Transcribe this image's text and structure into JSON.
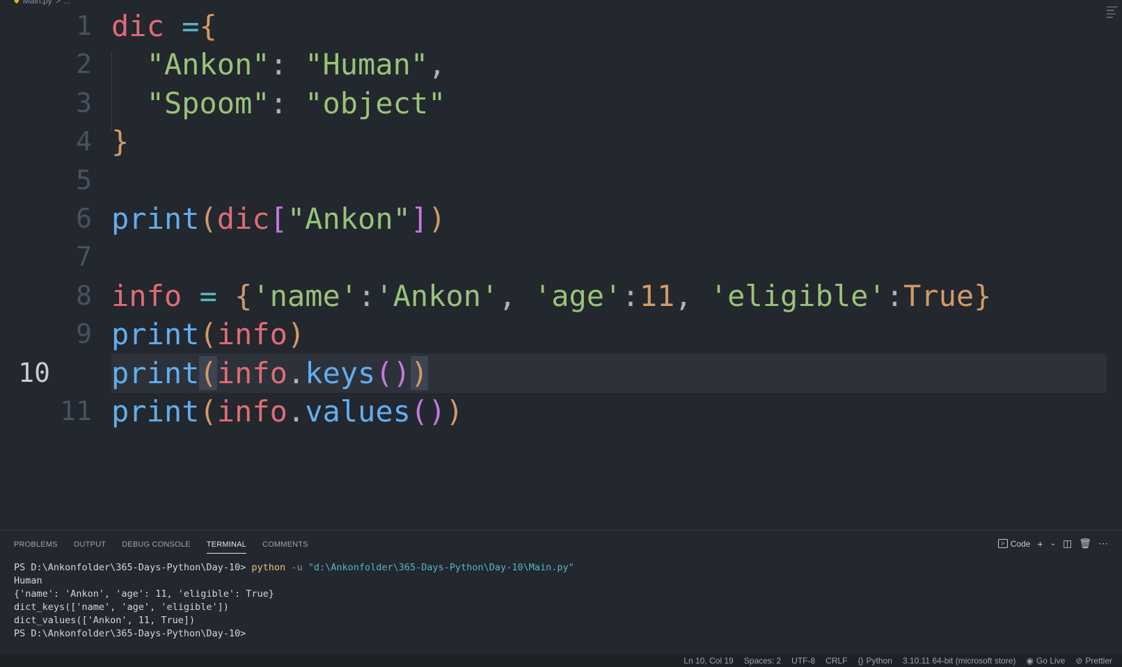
{
  "breadcrumb": {
    "file": "Main.py",
    "sep": ">",
    "rest": "..."
  },
  "editor": {
    "current_line": "10",
    "lines": [
      {
        "num": "1",
        "tokens": [
          {
            "t": "dic",
            "c": "t-var"
          },
          {
            "t": " ",
            "c": "t-punc"
          },
          {
            "t": "=",
            "c": "t-op"
          },
          {
            "t": "{",
            "c": "t-brace"
          }
        ]
      },
      {
        "num": "2",
        "tokens": [
          {
            "t": "  ",
            "c": "t-punc"
          },
          {
            "t": "\"Ankon\"",
            "c": "t-str"
          },
          {
            "t": ": ",
            "c": "t-punc"
          },
          {
            "t": "\"Human\"",
            "c": "t-str"
          },
          {
            "t": ",",
            "c": "t-punc"
          }
        ]
      },
      {
        "num": "3",
        "tokens": [
          {
            "t": "  ",
            "c": "t-punc"
          },
          {
            "t": "\"Spoom\"",
            "c": "t-str"
          },
          {
            "t": ": ",
            "c": "t-punc"
          },
          {
            "t": "\"object\"",
            "c": "t-str"
          }
        ]
      },
      {
        "num": "4",
        "tokens": [
          {
            "t": "}",
            "c": "t-brace"
          }
        ]
      },
      {
        "num": "5",
        "tokens": []
      },
      {
        "num": "6",
        "tokens": [
          {
            "t": "print",
            "c": "t-fn"
          },
          {
            "t": "(",
            "c": "t-paren1"
          },
          {
            "t": "dic",
            "c": "t-var"
          },
          {
            "t": "[",
            "c": "t-paren2"
          },
          {
            "t": "\"Ankon\"",
            "c": "t-str"
          },
          {
            "t": "]",
            "c": "t-paren2"
          },
          {
            "t": ")",
            "c": "t-paren1"
          }
        ]
      },
      {
        "num": "7",
        "tokens": []
      },
      {
        "num": "8",
        "tokens": [
          {
            "t": "info",
            "c": "t-var"
          },
          {
            "t": " ",
            "c": "t-punc"
          },
          {
            "t": "=",
            "c": "t-op"
          },
          {
            "t": " ",
            "c": "t-punc"
          },
          {
            "t": "{",
            "c": "t-brace"
          },
          {
            "t": "'name'",
            "c": "t-str"
          },
          {
            "t": ":",
            "c": "t-punc"
          },
          {
            "t": "'Ankon'",
            "c": "t-str"
          },
          {
            "t": ", ",
            "c": "t-punc"
          },
          {
            "t": "'age'",
            "c": "t-str"
          },
          {
            "t": ":",
            "c": "t-punc"
          },
          {
            "t": "11",
            "c": "t-num"
          },
          {
            "t": ", ",
            "c": "t-punc"
          },
          {
            "t": "'eligible'",
            "c": "t-str"
          },
          {
            "t": ":",
            "c": "t-punc"
          },
          {
            "t": "True",
            "c": "t-bool"
          },
          {
            "t": "}",
            "c": "t-brace"
          }
        ]
      },
      {
        "num": "9",
        "tokens": [
          {
            "t": "print",
            "c": "t-fn"
          },
          {
            "t": "(",
            "c": "t-paren1"
          },
          {
            "t": "info",
            "c": "t-var"
          },
          {
            "t": ")",
            "c": "t-paren1"
          }
        ]
      },
      {
        "num": "10",
        "tokens": [
          {
            "t": "print",
            "c": "t-fn"
          },
          {
            "t": "(",
            "c": "t-paren1 t-match"
          },
          {
            "t": "info",
            "c": "t-var"
          },
          {
            "t": ".",
            "c": "t-punc"
          },
          {
            "t": "keys",
            "c": "t-fn"
          },
          {
            "t": "(",
            "c": "t-paren2"
          },
          {
            "t": ")",
            "c": "t-paren2"
          },
          {
            "t": ")",
            "c": "t-paren1 t-match"
          }
        ]
      },
      {
        "num": "11",
        "tokens": [
          {
            "t": "print",
            "c": "t-fn"
          },
          {
            "t": "(",
            "c": "t-paren1"
          },
          {
            "t": "info",
            "c": "t-var"
          },
          {
            "t": ".",
            "c": "t-punc"
          },
          {
            "t": "values",
            "c": "t-fn"
          },
          {
            "t": "(",
            "c": "t-paren2"
          },
          {
            "t": ")",
            "c": "t-paren2"
          },
          {
            "t": ")",
            "c": "t-paren1"
          }
        ]
      }
    ]
  },
  "panel": {
    "tabs": [
      {
        "label": "PROBLEMS",
        "name": "tab-problems",
        "active": false
      },
      {
        "label": "OUTPUT",
        "name": "tab-output",
        "active": false
      },
      {
        "label": "DEBUG CONSOLE",
        "name": "tab-debug-console",
        "active": false
      },
      {
        "label": "TERMINAL",
        "name": "tab-terminal",
        "active": true
      },
      {
        "label": "COMMENTS",
        "name": "tab-comments",
        "active": false
      }
    ],
    "actions": {
      "launch_profile": "Code"
    }
  },
  "terminal": {
    "prompt": "PS D:\\Ankonfolder\\365-Days-Python\\Day-10>",
    "command": "python",
    "flag": "-u",
    "path": "\"d:\\Ankonfolder\\365-Days-Python\\Day-10\\Main.py\"",
    "output": [
      "Human",
      "{'name': 'Ankon', 'age': 11, 'eligible': True}",
      "dict_keys(['name', 'age', 'eligible'])",
      "dict_values(['Ankon', 11, True])"
    ],
    "final_prompt": "PS D:\\Ankonfolder\\365-Days-Python\\Day-10>"
  },
  "statusbar": {
    "position": "Ln 10, Col 19",
    "spaces": "Spaces: 2",
    "encoding": "UTF-8",
    "eol": "CRLF",
    "language": "Python",
    "interpreter": "3.10.11 64-bit (microsoft store)",
    "golive": "Go Live",
    "prettier": "Prettier"
  }
}
